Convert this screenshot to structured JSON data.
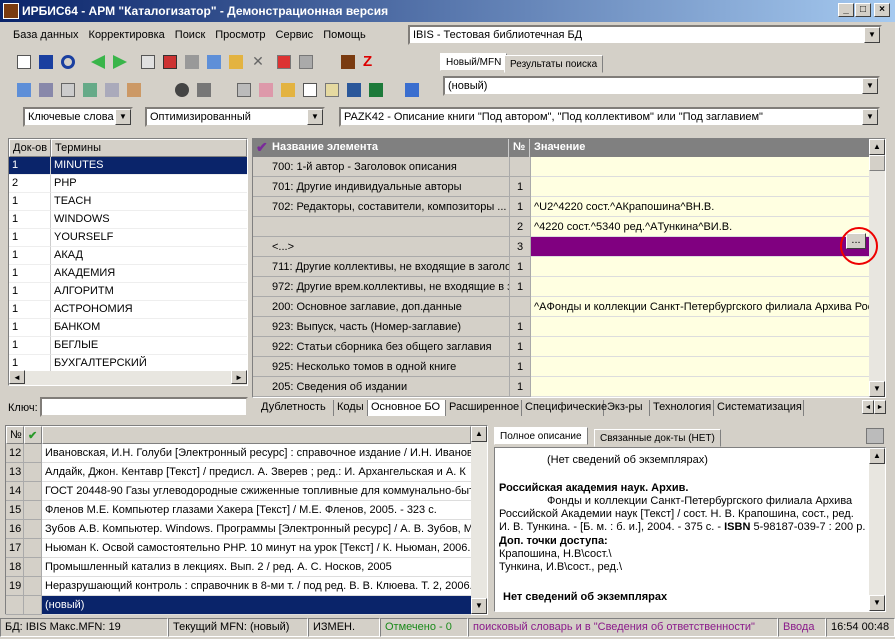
{
  "window": {
    "title": "ИРБИС64 - АРМ \"Каталогизатор\" - Демонстрационная версия",
    "btn_min": "_",
    "btn_max": "□",
    "btn_close": "×"
  },
  "menu": [
    "База данных",
    "Корректировка",
    "Поиск",
    "Просмотр",
    "Сервис",
    "Помощь"
  ],
  "database_select": "IBIS - Тестовая библиотечная БД",
  "record_tabs": [
    "Новый/MFN",
    "Результаты поиска"
  ],
  "record_select": "(новый)",
  "dict_mode_select": "Ключевые слова",
  "optimization_select": "Оптимизированный",
  "worksheet_select": "PAZK42 - Описание книги \"Под автором\", \"Под коллективом\" или \"Под заглавием\"",
  "dictionary": {
    "col_docs": "Док-ов",
    "col_terms": "Термины",
    "rows": [
      {
        "docs": "1",
        "term": "MINUTES"
      },
      {
        "docs": "2",
        "term": "PHP"
      },
      {
        "docs": "1",
        "term": "TEACH"
      },
      {
        "docs": "1",
        "term": "WINDOWS"
      },
      {
        "docs": "1",
        "term": "YOURSELF"
      },
      {
        "docs": "1",
        "term": "АКАД"
      },
      {
        "docs": "1",
        "term": "АКАДЕМИЯ"
      },
      {
        "docs": "1",
        "term": "АЛГОРИТМ"
      },
      {
        "docs": "1",
        "term": "АСТРОНОМИЯ"
      },
      {
        "docs": "1",
        "term": "БАНКОМ"
      },
      {
        "docs": "1",
        "term": "БЕГЛЫЕ"
      },
      {
        "docs": "1",
        "term": "БУХГАЛТЕРСКИЙ"
      }
    ],
    "key_label": "Ключ:",
    "key_value": ""
  },
  "editor": {
    "col_name": "Название элемента",
    "col_num": "№",
    "col_value": "Значение",
    "ellipsis_button": "...",
    "rows": [
      {
        "name": "700: 1-й автор - Заголовок описания",
        "num": "",
        "value": ""
      },
      {
        "name": "701: Другие индивидуальные авторы",
        "num": "1",
        "value": ""
      },
      {
        "name": "702: Редакторы, составители, композиторы ...",
        "num": "1",
        "value": "^U2^4220 сост.^AКрапошина^BН.В."
      },
      {
        "name": "",
        "num": "2",
        "value": "^4220 сост.^5340 ред.^AТункина^BИ.В."
      },
      {
        "name": "<...>",
        "num": "3",
        "value": ""
      },
      {
        "name": "711: Другие коллективы, не входящие в заголовок",
        "num": "1",
        "value": ""
      },
      {
        "name": "972: Другие врем.коллективы, не входящие в заголовок",
        "num": "1",
        "value": ""
      },
      {
        "name": "200: Основное заглавие, доп.данные",
        "num": "",
        "value": "^AФонды и коллекции Санкт-Петербургского филиала Архива Российской академии наук"
      },
      {
        "name": "923: Выпуск, часть (Номер-заглавие)",
        "num": "1",
        "value": ""
      },
      {
        "name": "922: Статьи сборника без общего заглавия",
        "num": "1",
        "value": ""
      },
      {
        "name": "925: Несколько томов в одной книге",
        "num": "1",
        "value": ""
      },
      {
        "name": "205: Сведения об издании",
        "num": "1",
        "value": ""
      }
    ],
    "tabs": [
      "Дублетность",
      "Коды",
      "Основное БО",
      "Расширенное",
      "Специфические",
      "Экз-ры",
      "Технология",
      "Систематизация"
    ]
  },
  "results": {
    "col_num": "№",
    "rows": [
      {
        "n": "12",
        "text": "Ивановская, И.Н. Голуби [Электронный ресурс] : справочное издание / И.Н. Ивановская"
      },
      {
        "n": "13",
        "text": "Алдайк, Джон. Кентавр [Текст] / предисл. А. Зверев ; ред.: И. Архангельская и А. К"
      },
      {
        "n": "14",
        "text": "ГОСТ 20448-90 Газы углеводородные сжиженные топливные для коммунально-бытового"
      },
      {
        "n": "15",
        "text": "Фленов М.Е. Компьютер глазами Хакера [Текст] / М.Е. Фленов, 2005. - 323 с."
      },
      {
        "n": "16",
        "text": "Зубов А.В. Компьютер. Windows. Программы [Электронный ресурс] / А. В. Зубов, М"
      },
      {
        "n": "17",
        "text": "Ньюман К. Освой самостоятельно PHP. 10 минут на урок [Текст] / К. Ньюман, 2006."
      },
      {
        "n": "18",
        "text": "Промышленный катализ в лекциях. Вып. 2 / ред. А. С. Носков, 2005"
      },
      {
        "n": "19",
        "text": "Неразрушающий контроль : справочник в 8-ми т. / под ред. В. В. Клюева. Т. 2, 2006."
      }
    ],
    "new_row": "(новый)"
  },
  "description": {
    "tabs": [
      "Полное описание",
      "Связанные док-ты (НЕТ)"
    ],
    "line1": "(Нет сведений об экземплярах)",
    "org": "Российская академия наук. Архив.",
    "body1": "Фонды и коллекции Санкт-Петербургского филиала Архива",
    "body2": "Российской Академии наук [Текст] / сост. Н. В. Крапошина, сост., ред.",
    "body3a": "И. В. Тункина. - [Б. м. : б. и.], 2004. - 375 с. - ",
    "isbn_label": "ISBN",
    "body3b": " 5-98187-039-7 : 200 р.",
    "access": "Доп. точки доступа:",
    "access1": "Крапошина, Н.В\\сост.\\",
    "access2": "Тункина, И.В\\сост., ред.\\",
    "no_items": "Нет сведений об экземплярах"
  },
  "status": {
    "db": "БД: IBIS Макс.MFN: 19",
    "mfn": "Текущий MFN: (новый)",
    "changed": "ИЗМЕН.",
    "marked": "Отмечено - 0",
    "hint": "поисковый словарь и в \"Сведения об ответственности\"",
    "input": "Ввода",
    "time": "16:54  00:48"
  }
}
